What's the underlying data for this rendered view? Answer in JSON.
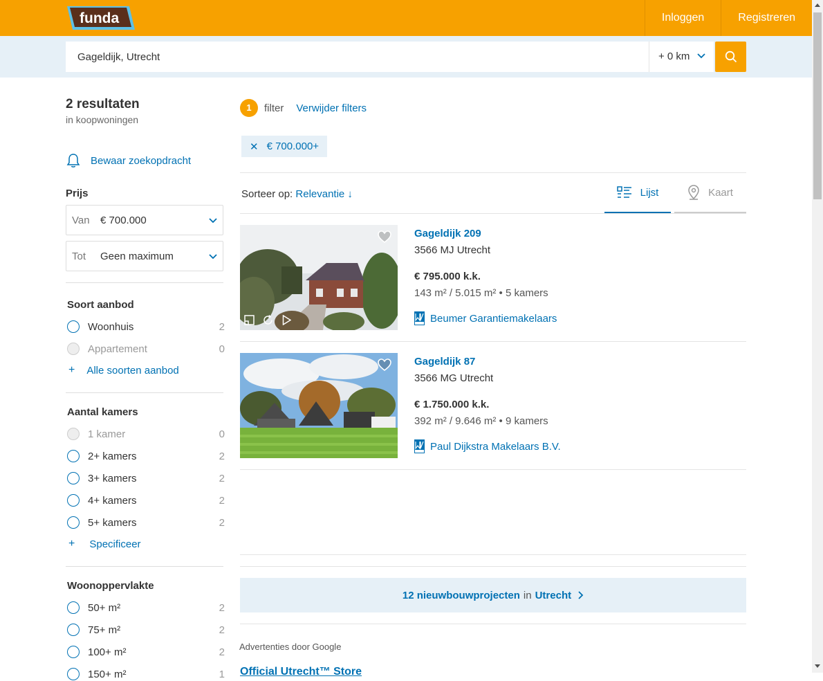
{
  "header": {
    "logo_text": "funda",
    "login_label": "Inloggen",
    "register_label": "Registreren",
    "brand_color": "#f7a100"
  },
  "search": {
    "value": "Gageldijk, Utrecht",
    "radius": "+ 0 km",
    "search_icon": "search-icon"
  },
  "sidebar": {
    "result_count": "2 resultaten",
    "result_scope": "in koopwoningen",
    "save_search": "Bewaar zoekopdracht",
    "price": {
      "title": "Prijs",
      "from_label": "Van",
      "from_value": "€ 700.000",
      "to_label": "Tot",
      "to_value": "Geen maximum"
    },
    "offer_type": {
      "title": "Soort aanbod",
      "options": [
        {
          "label": "Woonhuis",
          "count": "2",
          "disabled": false
        },
        {
          "label": "Appartement",
          "count": "0",
          "disabled": true
        }
      ],
      "more": "Alle soorten aanbod"
    },
    "rooms": {
      "title": "Aantal kamers",
      "options": [
        {
          "label": "1 kamer",
          "count": "0",
          "disabled": true
        },
        {
          "label": "2+ kamers",
          "count": "2",
          "disabled": false
        },
        {
          "label": "3+ kamers",
          "count": "2",
          "disabled": false
        },
        {
          "label": "4+ kamers",
          "count": "2",
          "disabled": false
        },
        {
          "label": "5+ kamers",
          "count": "2",
          "disabled": false
        }
      ],
      "more": "Specificeer"
    },
    "living_area": {
      "title": "Woonoppervlakte",
      "options": [
        {
          "label": "50+ m²",
          "count": "2",
          "disabled": false
        },
        {
          "label": "75+ m²",
          "count": "2",
          "disabled": false
        },
        {
          "label": "100+ m²",
          "count": "2",
          "disabled": false
        },
        {
          "label": "150+ m²",
          "count": "1",
          "disabled": false
        }
      ]
    }
  },
  "filters": {
    "count": "1",
    "label": "filter",
    "remove_label": "Verwijder filters",
    "chips": [
      {
        "label": "€ 700.000+"
      }
    ]
  },
  "sort": {
    "label": "Sorteer op:",
    "value": "Relevantie ↓"
  },
  "view_tabs": [
    {
      "label": "Lijst",
      "active": true
    },
    {
      "label": "Kaart",
      "active": false
    }
  ],
  "listings": [
    {
      "title": "Gageldijk 209",
      "address": "3566 MJ Utrecht",
      "price": "€ 795.000 k.k.",
      "specs": "143 m² / 5.015 m²  •  5 kamers",
      "agent": "Beumer Garantiemakelaars"
    },
    {
      "title": "Gageldijk 87",
      "address": "3566 MG Utrecht",
      "price": "€ 1.750.000 k.k.",
      "specs": "392 m² / 9.646 m²  •  9 kamers",
      "agent": "Paul Dijkstra Makelaars B.V."
    }
  ],
  "newbuild": {
    "count_text": "12 nieuwbouwprojecten",
    "in": "in",
    "city": "Utrecht"
  },
  "ads": {
    "label": "Advertenties door Google",
    "link": "Official Utrecht™ Store"
  }
}
